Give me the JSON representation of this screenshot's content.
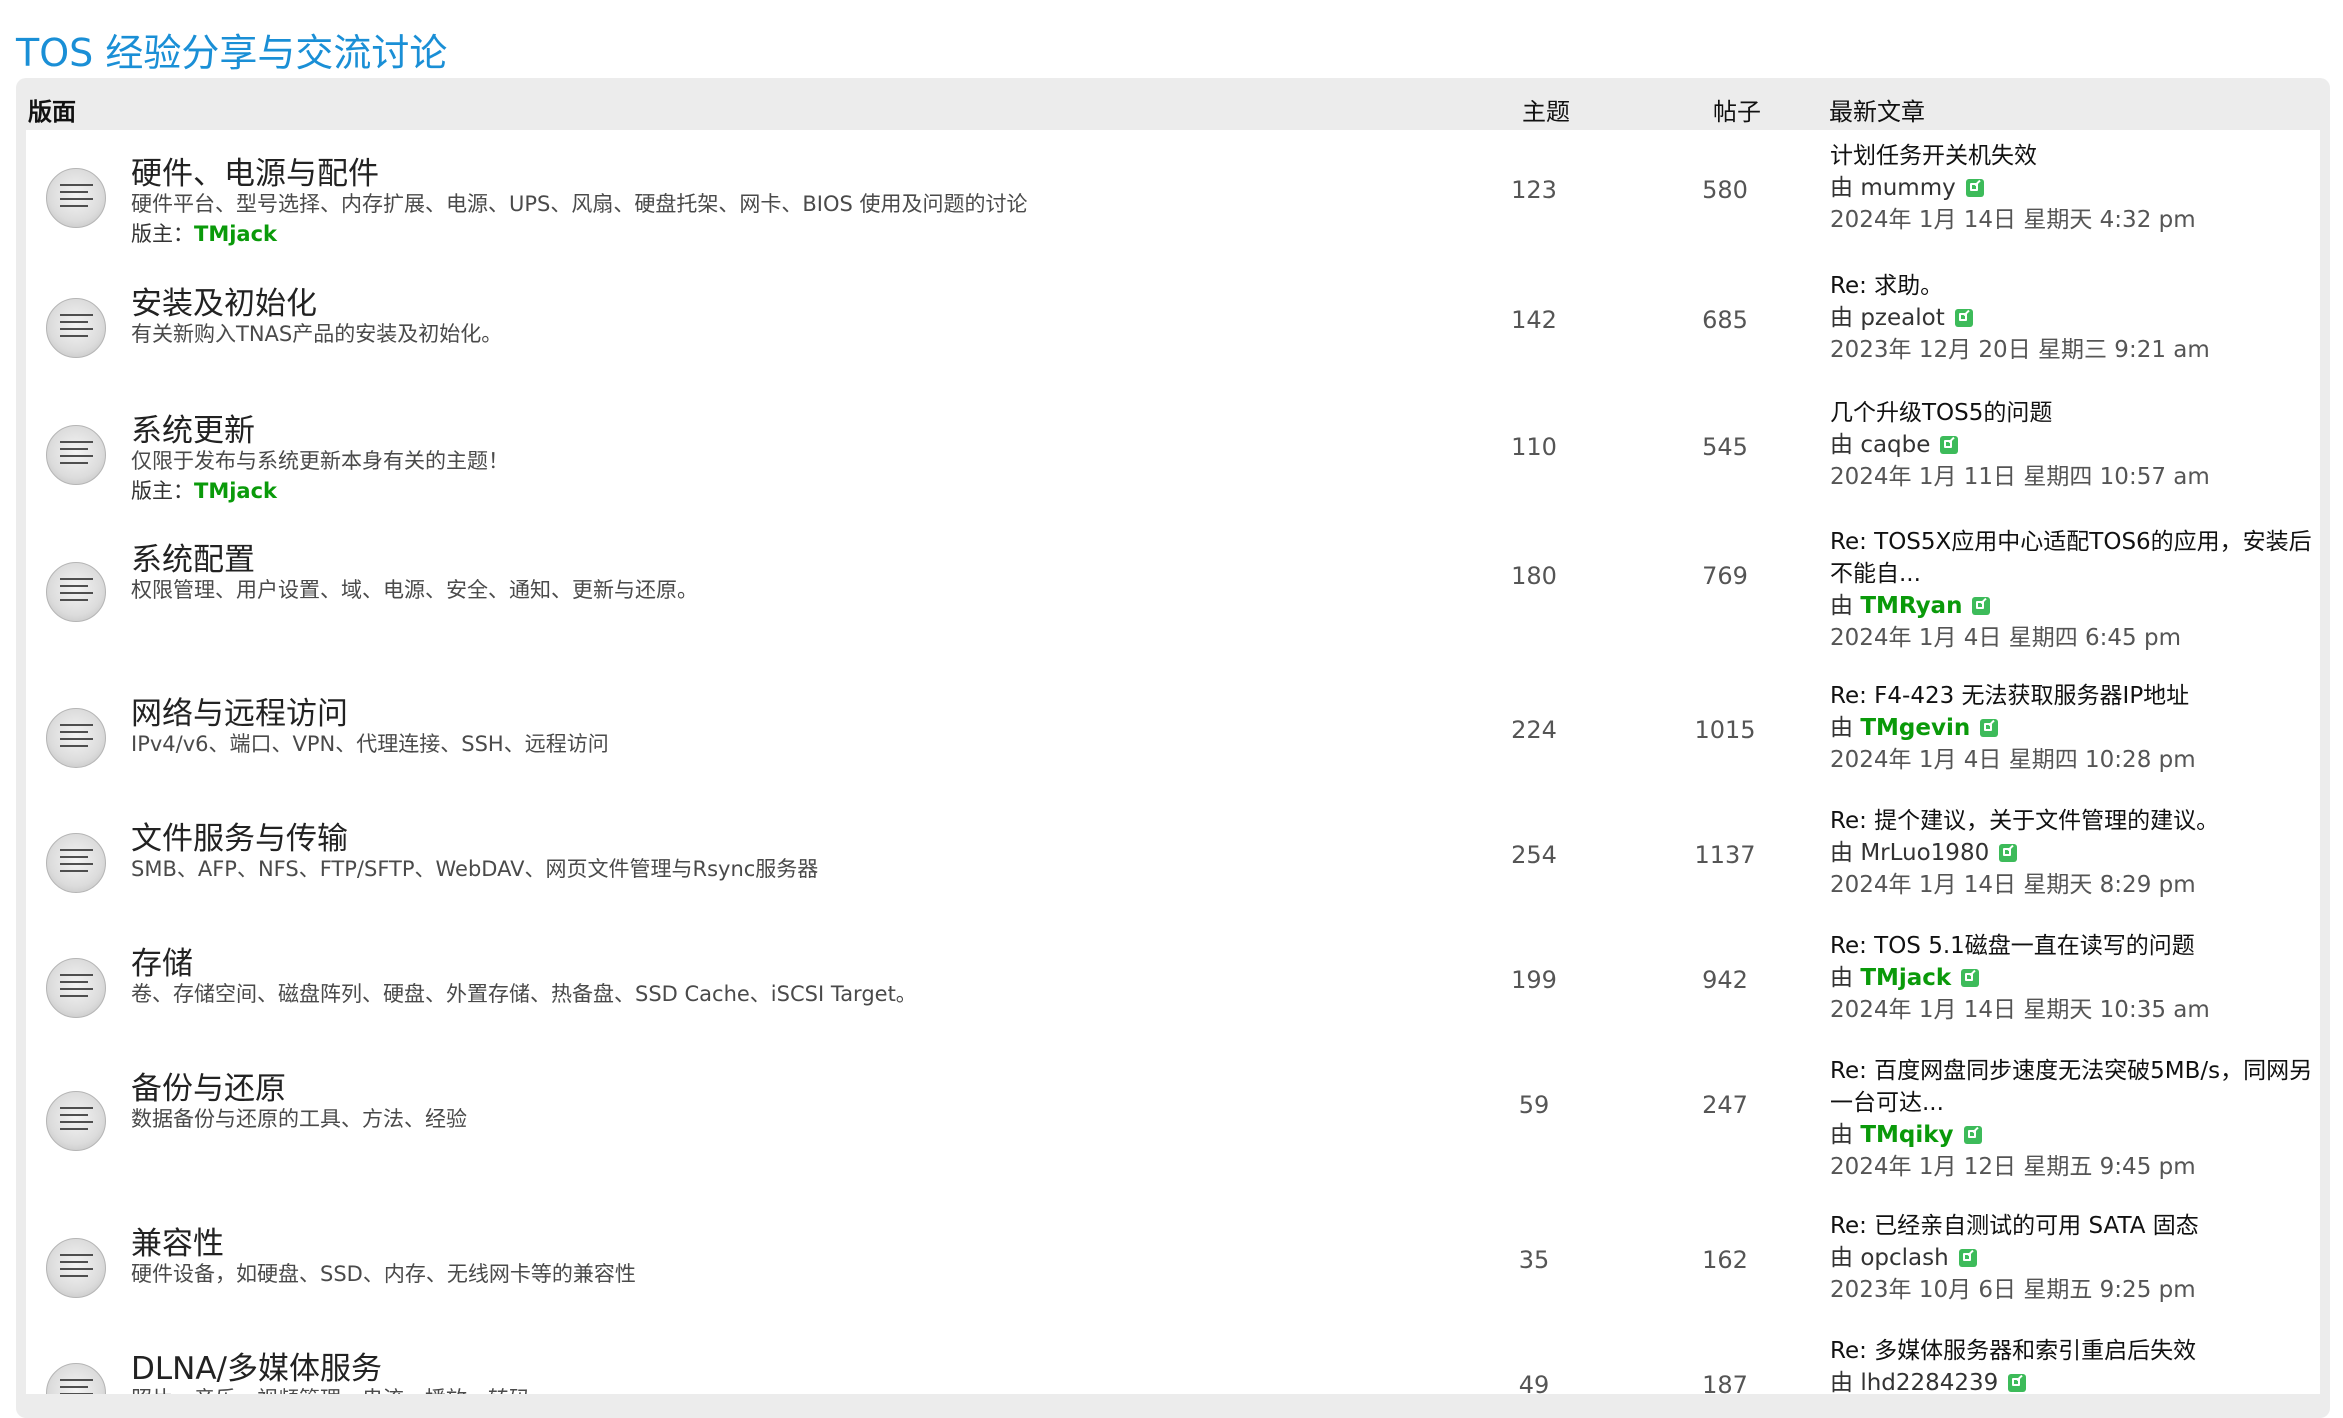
{
  "page_title": "TOS 经验分享与交流讨论",
  "header": {
    "forum": "版面",
    "topics": "主题",
    "posts": "帖子",
    "last_post": "最新文章"
  },
  "labels": {
    "moderator": "版主：",
    "by": "由"
  },
  "colors": {
    "title": "#1a8fd6",
    "moderator": "#0a9a0a",
    "goto_icon": "#3dbb5a"
  },
  "forums": [
    {
      "name": "硬件、电源与配件",
      "desc": "硬件平台、型号选择、内存扩展、电源、UPS、风扇、硬盘托架、网卡、BIOS 使用及问题的讨论",
      "moderator": "TMjack",
      "topics": "123",
      "posts": "580",
      "last_title": "计划任务开关机失效",
      "last_author": "mummy",
      "last_date": "2024年 1月 14日 星期天 4:32 pm"
    },
    {
      "name": "安装及初始化",
      "desc": "有关新购入TNAS产品的安装及初始化。",
      "moderator": "",
      "topics": "142",
      "posts": "685",
      "last_title": "Re: 求助。",
      "last_author": "pzealot",
      "last_date": "2023年 12月 20日 星期三 9:21 am"
    },
    {
      "name": "系统更新",
      "desc": "仅限于发布与系统更新本身有关的主题！",
      "moderator": "TMjack",
      "topics": "110",
      "posts": "545",
      "last_title": "几个升级TOS5的问题",
      "last_author": "caqbe",
      "last_date": "2024年 1月 11日 星期四 10:57 am"
    },
    {
      "name": "系统配置",
      "desc": "权限管理、用户设置、域、电源、安全、通知、更新与还原。",
      "moderator": "",
      "topics": "180",
      "posts": "769",
      "last_title": "Re: TOS5X应用中心适配TOS6的应用，安装后不能自...",
      "last_author": "TMRyan",
      "last_date": "2024年 1月 4日 星期四 6:45 pm"
    },
    {
      "name": "网络与远程访问",
      "desc": "IPv4/v6、端口、VPN、代理连接、SSH、远程访问",
      "moderator": "",
      "topics": "224",
      "posts": "1015",
      "last_title": "Re: F4-423 无法获取服务器IP地址",
      "last_author": "TMgevin",
      "last_date": "2024年 1月 4日 星期四 10:28 pm"
    },
    {
      "name": "文件服务与传输",
      "desc": "SMB、AFP、NFS、FTP/SFTP、WebDAV、网页文件管理与Rsync服务器",
      "moderator": "",
      "topics": "254",
      "posts": "1137",
      "last_title": "Re: 提个建议，关于文件管理的建议。",
      "last_author": "MrLuo1980",
      "last_date": "2024年 1月 14日 星期天 8:29 pm"
    },
    {
      "name": "存储",
      "desc": "卷、存储空间、磁盘阵列、硬盘、外置存储、热备盘、SSD Cache、iSCSI Target。",
      "moderator": "",
      "topics": "199",
      "posts": "942",
      "last_title": "Re: TOS 5.1磁盘一直在读写的问题",
      "last_author": "TMjack",
      "last_date": "2024年 1月 14日 星期天 10:35 am"
    },
    {
      "name": "备份与还原",
      "desc": "数据备份与还原的工具、方法、经验",
      "moderator": "",
      "topics": "59",
      "posts": "247",
      "last_title": "Re: 百度网盘同步速度无法突破5MB/s，同网另一台可达...",
      "last_author": "TMqiky",
      "last_date": "2024年 1月 12日 星期五 9:45 pm"
    },
    {
      "name": "兼容性",
      "desc": "硬件设备，如硬盘、SSD、内存、无线网卡等的兼容性",
      "moderator": "",
      "topics": "35",
      "posts": "162",
      "last_title": "Re: 已经亲自测试的可用 SATA 固态",
      "last_author": "opclash",
      "last_date": "2023年 10月 6日 星期五 9:25 pm"
    },
    {
      "name": "DLNA/多媒体服务",
      "desc": "照片、音乐、视频管理、串流、播放、转码",
      "moderator": "",
      "topics": "49",
      "posts": "187",
      "last_title": "Re: 多媒体服务器和索引重启后失效",
      "last_author": "lhd2284239",
      "last_date": ""
    }
  ]
}
